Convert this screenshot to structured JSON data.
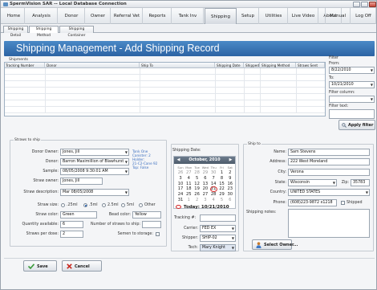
{
  "window": {
    "title": "SpermVision SAR -- Local Database Connection"
  },
  "menu": [
    "Home",
    "Analysis",
    "Donor",
    "Owner",
    "Referral Vet",
    "Reports",
    "Tank Inv",
    "Shipping",
    "Setup",
    "Utilities",
    "Live Video",
    "About",
    "Manual",
    "Log Off"
  ],
  "active_menu": "Shipping",
  "subtabs": [
    "Shipping Detail",
    "Shipping Method",
    "Shipping Container"
  ],
  "active_subtab": "Shipping Method",
  "header": {
    "title": "Shipping Management - Add Shipping Record"
  },
  "shipments": {
    "legend": "Shipments",
    "columns": [
      "Tracking Number",
      "Donor",
      "Ship To",
      "Shipping Date",
      "Shipped",
      "Shipping Method",
      "Straws Sent"
    ],
    "rows": []
  },
  "filter": {
    "legend": "Filter",
    "from_label": "From:",
    "from_value": "8/22/2010",
    "to_label": "To:",
    "to_value": "10/21/2010",
    "columns_label": "Filter column:",
    "columns_value": "",
    "text_label": "Filter text:",
    "text_value": "",
    "apply_label": "Apply filter"
  },
  "straws": {
    "legend": "Straws to ship",
    "donor_owner_label": "Donor Owner:",
    "donor_owner": "Jones, Jill",
    "donor_label": "Donor:",
    "donor": "Barron Maximillion of Blawhurst",
    "sample_label": "Sample:",
    "sample": "08/05/2008 9:30:01 AM",
    "straw_owner_label": "Straw owner:",
    "straw_owner": "Jones, Jill",
    "straw_desc_label": "Straw description:",
    "straw_desc": "Mar 08/05/2008",
    "info": [
      "Tank One",
      "Canister: 2",
      "Holder:",
      "21-C2-Cane 92",
      "Top: False"
    ],
    "straw_size_label": "Straw size:",
    "sizes": [
      ".25ml",
      ".5ml",
      "2.5ml",
      "5ml",
      "Other"
    ],
    "selected_size": ".5ml",
    "straw_color_label": "Straw color:",
    "straw_color": "Green",
    "bead_color_label": "Bead color:",
    "bead_color": "Yellow",
    "qty_label": "Quantity available:",
    "qty": "6",
    "num_straws_label": "Number of straws to ship:",
    "num_straws": "",
    "per_dose_label": "Straws per dose:",
    "per_dose": "2",
    "semen_storage_label": "Semen to storage:"
  },
  "shipping_date": {
    "legend": "Shipping Date:",
    "month_year": "October, 2010",
    "dow": [
      "Sun",
      "Mon",
      "Tue",
      "Wed",
      "Thu",
      "Fri",
      "Sat"
    ],
    "weeks": [
      [
        "26",
        "27",
        "28",
        "29",
        "30",
        "1",
        "2"
      ],
      [
        "3",
        "4",
        "5",
        "6",
        "7",
        "8",
        "9"
      ],
      [
        "10",
        "11",
        "12",
        "13",
        "14",
        "15",
        "16"
      ],
      [
        "17",
        "18",
        "19",
        "20",
        "21",
        "22",
        "23"
      ],
      [
        "24",
        "25",
        "26",
        "27",
        "28",
        "29",
        "30"
      ],
      [
        "31",
        "1",
        "2",
        "3",
        "4",
        "5",
        "6"
      ]
    ],
    "today_text": "Today: 10/21/2010",
    "today_day": "21"
  },
  "tracking": {
    "tracking_label": "Tracking #:",
    "tracking": "",
    "carrier_label": "Carrier:",
    "carrier": "FED EX",
    "shipper_label": "Shipper:",
    "shipper": "SHIP-02",
    "tech_label": "Tech:",
    "tech": "Mary Knight"
  },
  "ship_to": {
    "legend": "Ship to",
    "name_label": "Name:",
    "name": "Sam Stevens",
    "address_label": "Address:",
    "address": "222 West Moreland",
    "city_label": "City:",
    "city": "Verona",
    "state_label": "State:",
    "state": "Wisconsin",
    "zip_label": "Zip:",
    "zip": "35783",
    "country_label": "Country:",
    "country": "UNITED STATES",
    "phone_label": "Phone:",
    "phone": "(608)223-9872 x1218",
    "shipped_label": "Shipped",
    "notes_label": "Shipping notes:",
    "select_owner_label": "Select Owner..."
  },
  "actions": {
    "save": "Save",
    "cancel": "Cancel"
  },
  "colors": {
    "header_blue": "#3574b7",
    "link_blue": "#3c6fc0",
    "today_red": "#d42a2a",
    "save_green": "#3a9a3a",
    "cancel_red": "#c8281f"
  }
}
